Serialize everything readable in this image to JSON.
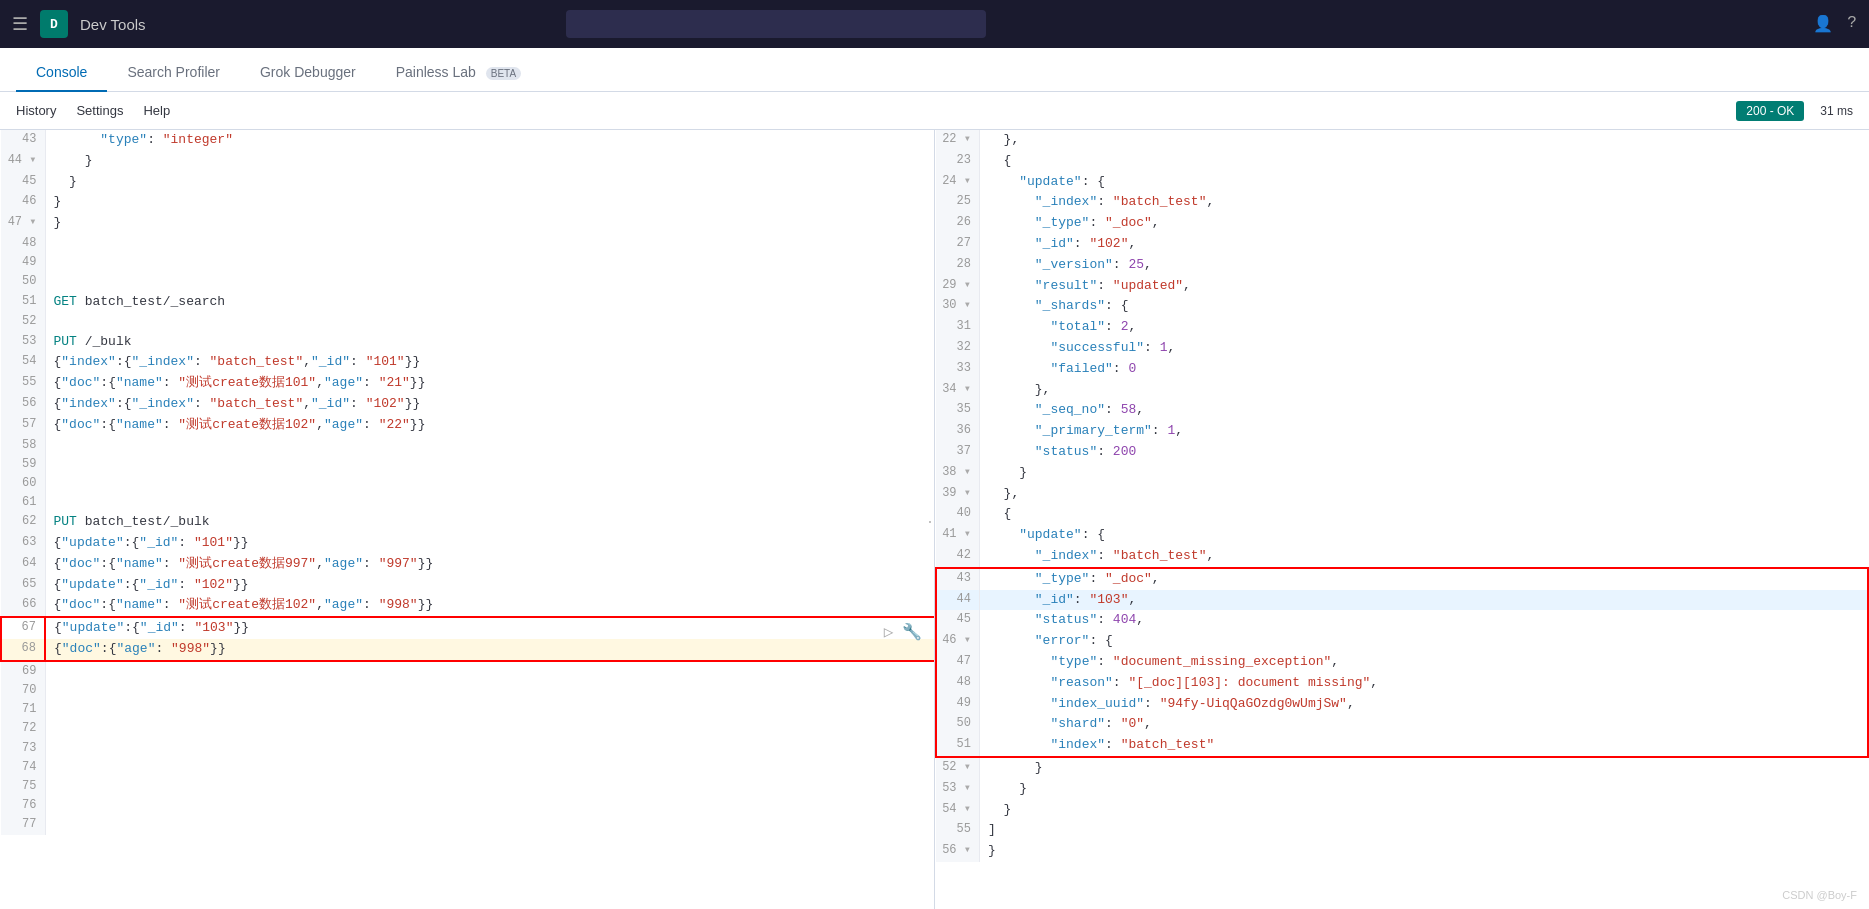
{
  "topbar": {
    "hamburger": "☰",
    "avatar_label": "D",
    "app_title": "Dev Tools",
    "search_placeholder": ""
  },
  "tabs": [
    {
      "id": "console",
      "label": "Console",
      "active": true
    },
    {
      "id": "search-profiler",
      "label": "Search Profiler",
      "active": false
    },
    {
      "id": "grok-debugger",
      "label": "Grok Debugger",
      "active": false
    },
    {
      "id": "painless-lab",
      "label": "Painless Lab",
      "active": false,
      "badge": "BETA"
    }
  ],
  "toolbar": {
    "history_label": "History",
    "settings_label": "Settings",
    "help_label": "Help",
    "status": "200 - OK",
    "time": "31 ms"
  },
  "editor": {
    "lines": [
      {
        "num": "43",
        "content": "      \"type\": \"integer\"",
        "fold": false,
        "highlight": false
      },
      {
        "num": "44",
        "content": "    }",
        "fold": true,
        "highlight": false
      },
      {
        "num": "45",
        "content": "  }",
        "fold": false,
        "highlight": false
      },
      {
        "num": "46",
        "content": "}",
        "fold": false,
        "highlight": false
      },
      {
        "num": "47",
        "content": "}",
        "fold": true,
        "highlight": false
      },
      {
        "num": "48",
        "content": "",
        "fold": false,
        "highlight": false
      },
      {
        "num": "49",
        "content": "",
        "fold": false,
        "highlight": false
      },
      {
        "num": "50",
        "content": "",
        "fold": false,
        "highlight": false
      },
      {
        "num": "51",
        "content": "GET batch_test/_search",
        "fold": false,
        "highlight": false,
        "method": "GET"
      },
      {
        "num": "52",
        "content": "",
        "fold": false,
        "highlight": false
      },
      {
        "num": "53",
        "content": "PUT /_bulk",
        "fold": false,
        "highlight": false,
        "method": "PUT"
      },
      {
        "num": "54",
        "content": "{\"index\":{\"_index\":\"batch_test\",\"_id\":\"101\"}}",
        "fold": false,
        "highlight": false
      },
      {
        "num": "55",
        "content": "{\"doc\":{\"name\":\"测试create数据101\",\"age\":\"21\"}}",
        "fold": false,
        "highlight": false
      },
      {
        "num": "56",
        "content": "{\"index\":{\"_index\":\"batch_test\",\"_id\":\"102\"}}",
        "fold": false,
        "highlight": false
      },
      {
        "num": "57",
        "content": "{\"doc\":{\"name\":\"测试create数据102\",\"age\":\"22\"}}",
        "fold": false,
        "highlight": false
      },
      {
        "num": "58",
        "content": "",
        "fold": false,
        "highlight": false
      },
      {
        "num": "59",
        "content": "",
        "fold": false,
        "highlight": false
      },
      {
        "num": "60",
        "content": "",
        "fold": false,
        "highlight": false
      },
      {
        "num": "61",
        "content": "",
        "fold": false,
        "highlight": false
      },
      {
        "num": "62",
        "content": "PUT batch_test/_bulk",
        "fold": false,
        "highlight": false,
        "method": "PUT"
      },
      {
        "num": "63",
        "content": "{\"update\":{\"_id\":\"101\"}}",
        "fold": false,
        "highlight": false
      },
      {
        "num": "64",
        "content": "{\"doc\":{\"name\":\"测试create数据997\",\"age\":\"997\"}}",
        "fold": false,
        "highlight": false
      },
      {
        "num": "65",
        "content": "{\"update\":{\"_id\":\"102\"}}",
        "fold": false,
        "highlight": false
      },
      {
        "num": "66",
        "content": "{\"doc\":{\"name\":\"测试create数据102\",\"age\":\"998\"}}",
        "fold": false,
        "highlight": false
      },
      {
        "num": "67",
        "content": "{\"update\":{\"_id\":\"103\"}}",
        "fold": false,
        "highlight": true,
        "error": true
      },
      {
        "num": "68",
        "content": "{\"doc\":{\"age\":\"998\"}}",
        "fold": false,
        "highlight": true,
        "error": true
      },
      {
        "num": "69",
        "content": "",
        "fold": false,
        "highlight": false
      },
      {
        "num": "70",
        "content": "",
        "fold": false,
        "highlight": false
      },
      {
        "num": "71",
        "content": "",
        "fold": false,
        "highlight": false
      },
      {
        "num": "72",
        "content": "",
        "fold": false,
        "highlight": false
      },
      {
        "num": "73",
        "content": "",
        "fold": false,
        "highlight": false
      },
      {
        "num": "74",
        "content": "",
        "fold": false,
        "highlight": false
      },
      {
        "num": "75",
        "content": "",
        "fold": false,
        "highlight": false
      },
      {
        "num": "76",
        "content": "",
        "fold": false,
        "highlight": false
      },
      {
        "num": "77",
        "content": "",
        "fold": false,
        "highlight": false
      }
    ]
  },
  "output": {
    "lines": [
      {
        "num": "22",
        "content": "  },",
        "fold": true
      },
      {
        "num": "23",
        "content": "  {",
        "fold": false
      },
      {
        "num": "24",
        "content": "    \"update\" : {",
        "fold": true
      },
      {
        "num": "25",
        "content": "      \"_index\" : \"batch_test\",",
        "fold": false
      },
      {
        "num": "26",
        "content": "      \"_type\" : \"_doc\",",
        "fold": false
      },
      {
        "num": "27",
        "content": "      \"_id\" : \"102\",",
        "fold": false
      },
      {
        "num": "28",
        "content": "      \"_version\" : 25,",
        "fold": false
      },
      {
        "num": "29",
        "content": "      \"result\" : \"updated\",",
        "fold": true
      },
      {
        "num": "30",
        "content": "      \"_shards\" : {",
        "fold": true
      },
      {
        "num": "31",
        "content": "        \"total\" : 2,",
        "fold": false
      },
      {
        "num": "32",
        "content": "        \"successful\" : 1,",
        "fold": false
      },
      {
        "num": "33",
        "content": "        \"failed\" : 0",
        "fold": false
      },
      {
        "num": "34",
        "content": "      },",
        "fold": true
      },
      {
        "num": "35",
        "content": "      \"_seq_no\" : 58,",
        "fold": false
      },
      {
        "num": "36",
        "content": "      \"_primary_term\" : 1,",
        "fold": false
      },
      {
        "num": "37",
        "content": "      \"status\" : 200",
        "fold": false
      },
      {
        "num": "38",
        "content": "    }",
        "fold": true
      },
      {
        "num": "39",
        "content": "  },",
        "fold": true
      },
      {
        "num": "40",
        "content": "  {",
        "fold": false
      },
      {
        "num": "41",
        "content": "    \"update\" : {",
        "fold": true
      },
      {
        "num": "42",
        "content": "      \"_index\" : \"batch_test\",",
        "fold": false
      },
      {
        "num": "43",
        "content": "      \"_type\" : \"_doc\",",
        "fold": false,
        "error_start": true
      },
      {
        "num": "44",
        "content": "      \"_id\" : \"103\",",
        "fold": false,
        "selected": true
      },
      {
        "num": "45",
        "content": "      \"status\" : 404,",
        "fold": false
      },
      {
        "num": "46",
        "content": "      \"error\" : {",
        "fold": true
      },
      {
        "num": "47",
        "content": "        \"type\" : \"document_missing_exception\",",
        "fold": false
      },
      {
        "num": "48",
        "content": "        \"reason\" : \"[_doc][103]: document missing\",",
        "fold": false
      },
      {
        "num": "49",
        "content": "        \"index_uuid\" : \"94fy-UiqQaGOzdg0wUmjSw\",",
        "fold": false
      },
      {
        "num": "50",
        "content": "        \"shard\" : \"0\",",
        "fold": false
      },
      {
        "num": "51",
        "content": "        \"index\" : \"batch_test\"",
        "fold": false,
        "error_end": true
      },
      {
        "num": "52",
        "content": "      }",
        "fold": true
      },
      {
        "num": "53",
        "content": "    }",
        "fold": true
      },
      {
        "num": "54",
        "content": "  }",
        "fold": true
      },
      {
        "num": "55",
        "content": "]",
        "fold": false
      },
      {
        "num": "56",
        "content": "}",
        "fold": true
      }
    ]
  },
  "watermark": "CSDN @Boy-F"
}
